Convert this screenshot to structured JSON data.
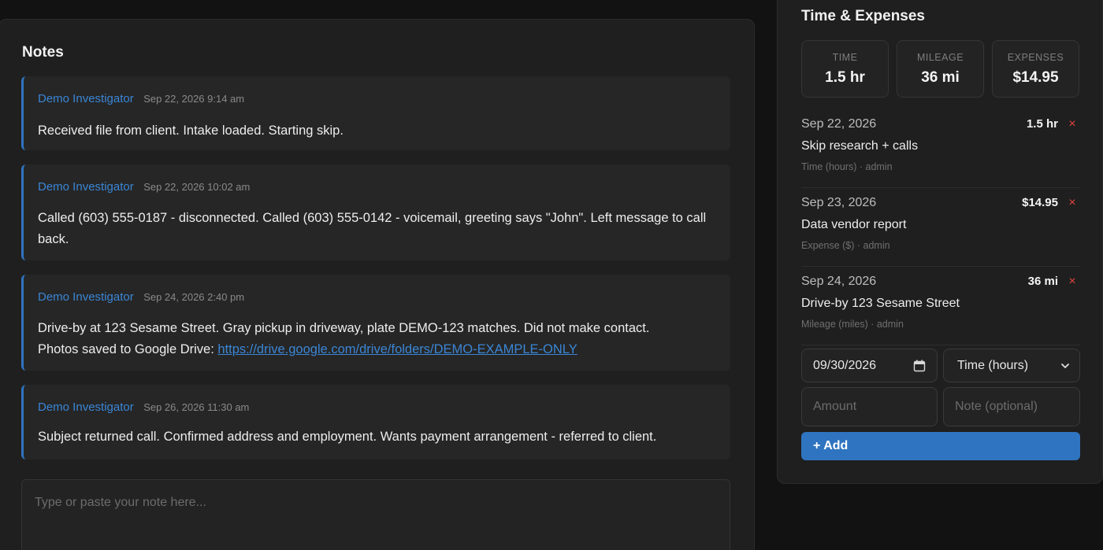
{
  "notes": {
    "title": "Notes",
    "items": [
      {
        "author": "Demo Investigator",
        "time": "Sep 22, 2026 9:14 am",
        "body": "Received file from client. Intake loaded. Starting skip."
      },
      {
        "author": "Demo Investigator",
        "time": "Sep 22, 2026 10:02 am",
        "body": "Called (603) 555-0187 - disconnected. Called (603) 555-0142 - voicemail, greeting says \"John\". Left message to call back."
      },
      {
        "author": "Demo Investigator",
        "time": "Sep 24, 2026 2:40 pm",
        "body": "Drive-by at 123 Sesame Street. Gray pickup in driveway, plate DEMO-123 matches. Did not make contact.",
        "body2": "Photos saved to Google Drive: ",
        "link": "https://drive.google.com/drive/folders/DEMO-EXAMPLE-ONLY"
      },
      {
        "author": "Demo Investigator",
        "time": "Sep 26, 2026 11:30 am",
        "body": "Subject returned call. Confirmed address and employment. Wants payment arrangement - referred to client."
      }
    ],
    "input_placeholder": "Type or paste your note here..."
  },
  "time_expenses": {
    "title": "Time & Expenses",
    "stats": [
      {
        "label": "Time",
        "value": "1.5 hr"
      },
      {
        "label": "Mileage",
        "value": "36 mi"
      },
      {
        "label": "Expenses",
        "value": "$14.95"
      }
    ],
    "entries": [
      {
        "date": "Sep 22, 2026",
        "amount": "1.5 hr",
        "description": "Skip research + calls",
        "meta": "Time (hours) · admin"
      },
      {
        "date": "Sep 23, 2026",
        "amount": "$14.95",
        "description": "Data vendor report",
        "meta": "Expense ($) · admin"
      },
      {
        "date": "Sep 24, 2026",
        "amount": "36 mi",
        "description": "Drive-by 123 Sesame Street",
        "meta": "Mileage (miles) · admin"
      }
    ],
    "form": {
      "date_value": "09/30/2026",
      "type_selected": "Time (hours)",
      "amount_placeholder": "Amount",
      "note_placeholder": "Note (optional)",
      "add_label": "+ Add"
    },
    "delete_glyph": "×"
  },
  "colors": {
    "accent": "#2f74c0",
    "link": "#3a86d6",
    "danger": "#e0443e",
    "panel_bg": "#1f1f1f",
    "page_bg": "#121212"
  },
  "icons": {
    "date_picker": "calendar-icon",
    "select": "chevron-down-icon",
    "delete": "close-icon"
  }
}
